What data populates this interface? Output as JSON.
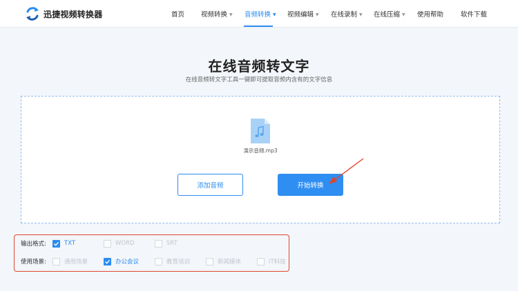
{
  "brand": {
    "name": "迅捷视频转换器"
  },
  "nav": {
    "items": [
      {
        "label": "首页",
        "dropdown": false,
        "active": false
      },
      {
        "label": "视频转换",
        "dropdown": true,
        "active": false
      },
      {
        "label": "音频转换",
        "dropdown": true,
        "active": true
      },
      {
        "label": "视频编辑",
        "dropdown": true,
        "active": false
      },
      {
        "label": "在线录制",
        "dropdown": true,
        "active": false
      },
      {
        "label": "在线压缩",
        "dropdown": true,
        "active": false
      },
      {
        "label": "使用帮助",
        "dropdown": false,
        "active": false
      },
      {
        "label": "软件下载",
        "dropdown": false,
        "active": false
      }
    ],
    "dropdown_icon": "caret-down-icon"
  },
  "page": {
    "title": "在线音频转文字",
    "subtitle": "在线音频转文字工具一键即可提取音频内含有的文字信息"
  },
  "upload": {
    "file_icon": "audio-file-icon",
    "file_name": "演示音频.mp3"
  },
  "buttons": {
    "add_audio": "添加音频",
    "start_convert": "开始转换"
  },
  "options": {
    "format": {
      "label": "输出格式:",
      "choices": [
        {
          "text": "TXT",
          "checked": true
        },
        {
          "text": "WORD",
          "checked": false
        },
        {
          "text": "SRT",
          "checked": false
        }
      ]
    },
    "scene": {
      "label": "使用场景:",
      "choices": [
        {
          "text": "通用场景",
          "checked": false
        },
        {
          "text": "办公会议",
          "checked": true
        },
        {
          "text": "教育培训",
          "checked": false
        },
        {
          "text": "新闻媒体",
          "checked": false
        },
        {
          "text": "IT科技",
          "checked": false
        }
      ]
    }
  },
  "colors": {
    "accent": "#2b8cf0",
    "annotation_red": "#e0452f",
    "drop_border": "#8fbcf0",
    "background": "#f3f6fa"
  }
}
